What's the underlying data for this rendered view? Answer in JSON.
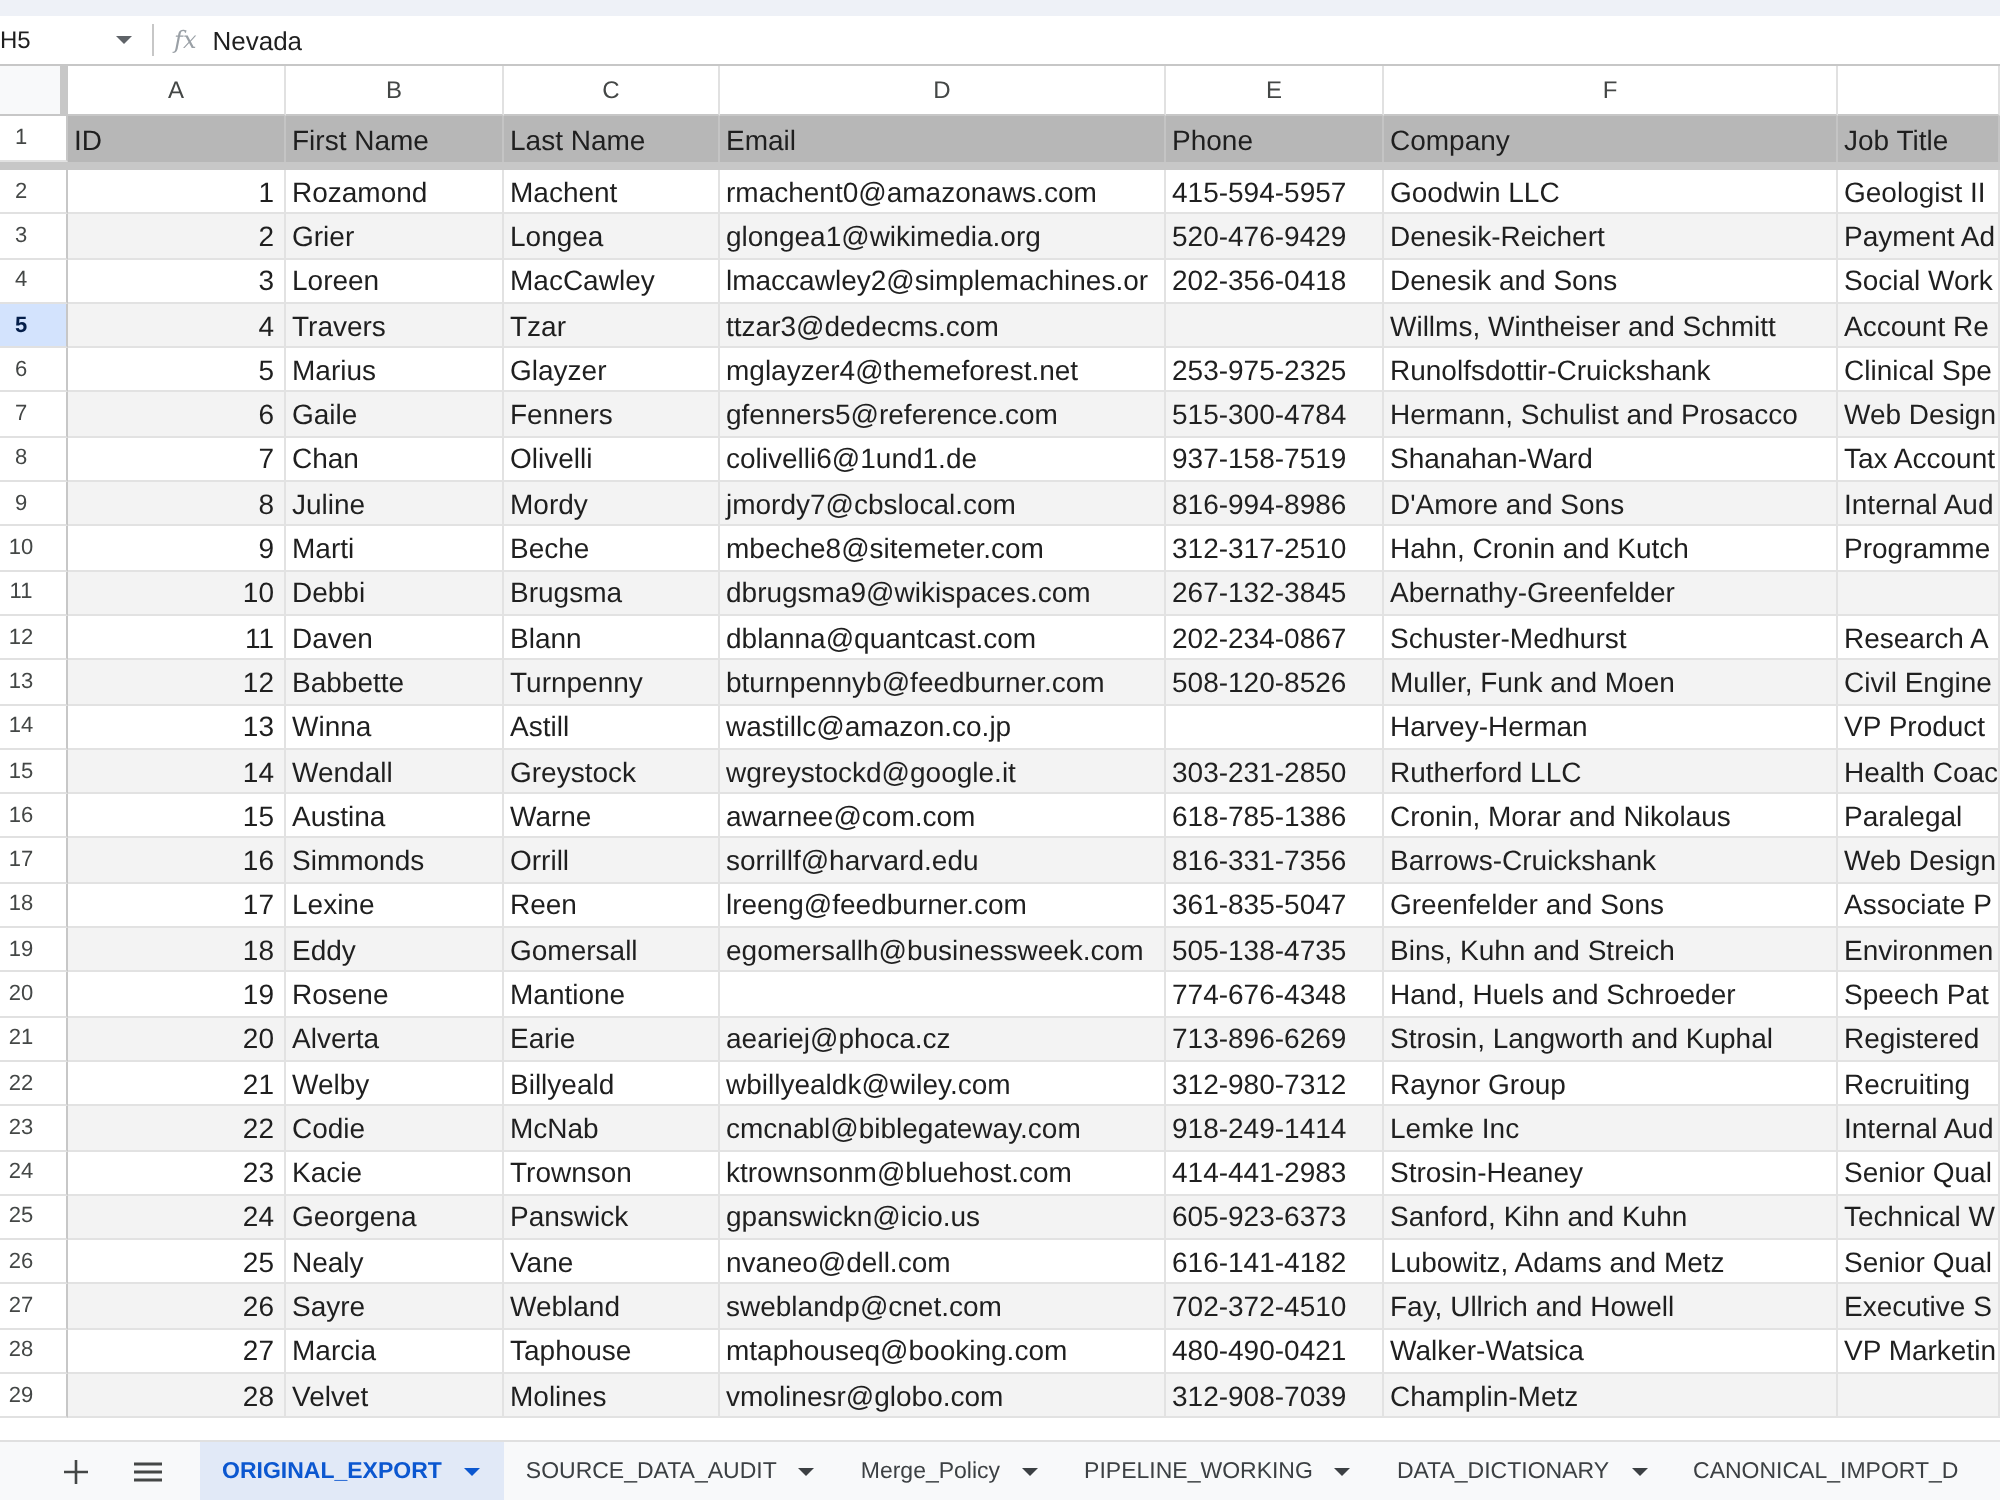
{
  "formula_bar": {
    "cell_ref": "H5",
    "function_symbol": "fx",
    "value": "Nevada"
  },
  "sheet": {
    "columns": [
      {
        "letter": "A",
        "kind": "number"
      },
      {
        "letter": "B",
        "kind": "text"
      },
      {
        "letter": "C",
        "kind": "text"
      },
      {
        "letter": "D",
        "kind": "text"
      },
      {
        "letter": "E",
        "kind": "text"
      },
      {
        "letter": "F",
        "kind": "text"
      },
      {
        "kind": "text"
      }
    ],
    "header_row": {
      "number": "1",
      "selected": false,
      "cells": [
        "ID",
        "First Name",
        "Last Name",
        "Email",
        "Phone",
        "Company",
        "Job Title"
      ]
    },
    "rows": [
      {
        "number": "2",
        "selected": false,
        "cells": [
          "1",
          "Rozamond",
          "Machent",
          "rmachent0@amazonaws.com",
          "415-594-5957",
          "Goodwin LLC",
          "Geologist II"
        ]
      },
      {
        "number": "3",
        "selected": false,
        "cells": [
          "2",
          "Grier",
          "Longea",
          "glongea1@wikimedia.org",
          "520-476-9429",
          "Denesik-Reichert",
          "Payment Ad"
        ]
      },
      {
        "number": "4",
        "selected": false,
        "cells": [
          "3",
          "Loreen",
          "MacCawley",
          "lmaccawley2@simplemachines.or",
          "202-356-0418",
          "Denesik and Sons",
          "Social Work"
        ]
      },
      {
        "number": "5",
        "selected": true,
        "cells": [
          "4",
          "Travers",
          "Tzar",
          "ttzar3@dedecms.com",
          null,
          "Willms, Wintheiser and Schmitt",
          "Account Re"
        ]
      },
      {
        "number": "6",
        "selected": false,
        "cells": [
          "5",
          "Marius",
          "Glayzer",
          "mglayzer4@themeforest.net",
          "253-975-2325",
          "Runolfsdottir-Cruickshank",
          "Clinical Spe"
        ]
      },
      {
        "number": "7",
        "selected": false,
        "cells": [
          "6",
          "Gaile",
          "Fenners",
          "gfenners5@reference.com",
          "515-300-4784",
          "Hermann, Schulist and Prosacco",
          "Web Design"
        ]
      },
      {
        "number": "8",
        "selected": false,
        "cells": [
          "7",
          "Chan",
          "Olivelli",
          "colivelli6@1und1.de",
          "937-158-7519",
          "Shanahan-Ward",
          "Tax Account"
        ]
      },
      {
        "number": "9",
        "selected": false,
        "cells": [
          "8",
          "Juline",
          "Mordy",
          "jmordy7@cbslocal.com",
          "816-994-8986",
          "D'Amore and Sons",
          "Internal Aud"
        ]
      },
      {
        "number": "10",
        "selected": false,
        "cells": [
          "9",
          "Marti",
          "Beche",
          "mbeche8@sitemeter.com",
          "312-317-2510",
          "Hahn, Cronin and Kutch",
          "Programme"
        ]
      },
      {
        "number": "11",
        "selected": false,
        "cells": [
          "10",
          "Debbi",
          "Brugsma",
          "dbrugsma9@wikispaces.com",
          "267-132-3845",
          "Abernathy-Greenfelder",
          null
        ]
      },
      {
        "number": "12",
        "selected": false,
        "cells": [
          "11",
          "Daven",
          "Blann",
          "dblanna@quantcast.com",
          "202-234-0867",
          "Schuster-Medhurst",
          "Research A"
        ]
      },
      {
        "number": "13",
        "selected": false,
        "cells": [
          "12",
          "Babbette",
          "Turnpenny",
          "bturnpennyb@feedburner.com",
          "508-120-8526",
          "Muller, Funk and Moen",
          "Civil Engine"
        ]
      },
      {
        "number": "14",
        "selected": false,
        "cells": [
          "13",
          "Winna",
          "Astill",
          "wastillc@amazon.co.jp",
          null,
          "Harvey-Herman",
          "VP Product"
        ]
      },
      {
        "number": "15",
        "selected": false,
        "cells": [
          "14",
          "Wendall",
          "Greystock",
          "wgreystockd@google.it",
          "303-231-2850",
          "Rutherford LLC",
          "Health Coac"
        ]
      },
      {
        "number": "16",
        "selected": false,
        "cells": [
          "15",
          "Austina",
          "Warne",
          "awarnee@com.com",
          "618-785-1386",
          "Cronin, Morar and Nikolaus",
          "Paralegal"
        ]
      },
      {
        "number": "17",
        "selected": false,
        "cells": [
          "16",
          "Simmonds",
          "Orrill",
          "sorrillf@harvard.edu",
          "816-331-7356",
          "Barrows-Cruickshank",
          "Web Design"
        ]
      },
      {
        "number": "18",
        "selected": false,
        "cells": [
          "17",
          "Lexine",
          "Reen",
          "lreeng@feedburner.com",
          "361-835-5047",
          "Greenfelder and Sons",
          "Associate P"
        ]
      },
      {
        "number": "19",
        "selected": false,
        "cells": [
          "18",
          "Eddy",
          "Gomersall",
          "egomersallh@businessweek.com",
          "505-138-4735",
          "Bins, Kuhn and Streich",
          "Environmen"
        ]
      },
      {
        "number": "20",
        "selected": false,
        "cells": [
          "19",
          "Rosene",
          "Mantione",
          null,
          "774-676-4348",
          "Hand, Huels and Schroeder",
          "Speech Pat"
        ]
      },
      {
        "number": "21",
        "selected": false,
        "cells": [
          "20",
          "Alverta",
          "Earie",
          "aeariej@phoca.cz",
          "713-896-6269",
          "Strosin, Langworth and Kuphal",
          "Registered"
        ]
      },
      {
        "number": "22",
        "selected": false,
        "cells": [
          "21",
          "Welby",
          "Billyeald",
          "wbillyealdk@wiley.com",
          "312-980-7312",
          "Raynor Group",
          "Recruiting"
        ]
      },
      {
        "number": "23",
        "selected": false,
        "cells": [
          "22",
          "Codie",
          "McNab",
          "cmcnabl@biblegateway.com",
          "918-249-1414",
          "Lemke Inc",
          "Internal Aud"
        ]
      },
      {
        "number": "24",
        "selected": false,
        "cells": [
          "23",
          "Kacie",
          "Trownson",
          "ktrownsonm@bluehost.com",
          "414-441-2983",
          "Strosin-Heaney",
          "Senior Qual"
        ]
      },
      {
        "number": "25",
        "selected": false,
        "cells": [
          "24",
          "Georgena",
          "Panswick",
          "gpanswickn@icio.us",
          "605-923-6373",
          "Sanford, Kihn and Kuhn",
          "Technical W"
        ]
      },
      {
        "number": "26",
        "selected": false,
        "cells": [
          "25",
          "Nealy",
          "Vane",
          "nvaneo@dell.com",
          "616-141-4182",
          "Lubowitz, Adams and Metz",
          "Senior Qual"
        ]
      },
      {
        "number": "27",
        "selected": false,
        "cells": [
          "26",
          "Sayre",
          "Webland",
          "sweblandp@cnet.com",
          "702-372-4510",
          "Fay, Ullrich and Howell",
          "Executive S"
        ]
      },
      {
        "number": "28",
        "selected": false,
        "cells": [
          "27",
          "Marcia",
          "Taphouse",
          "mtaphouseq@booking.com",
          "480-490-0421",
          "Walker-Watsica",
          "VP Marketin"
        ]
      },
      {
        "number": "29",
        "selected": false,
        "cells": [
          "28",
          "Velvet",
          "Molines",
          "vmolinesr@globo.com",
          "312-908-7039",
          "Champlin-Metz",
          null
        ]
      }
    ]
  },
  "sheet_tabs": [
    {
      "label": "ORIGINAL_EXPORT",
      "selected": true,
      "dropdown": true
    },
    {
      "label": "SOURCE_DATA_AUDIT",
      "selected": false,
      "dropdown": true
    },
    {
      "label": "Merge_Policy",
      "selected": false,
      "dropdown": true
    },
    {
      "label": "PIPELINE_WORKING",
      "selected": false,
      "dropdown": true
    },
    {
      "label": "DATA_DICTIONARY",
      "selected": false,
      "dropdown": true
    },
    {
      "label": "CANONICAL_IMPORT_D",
      "selected": false,
      "dropdown": false
    }
  ]
}
